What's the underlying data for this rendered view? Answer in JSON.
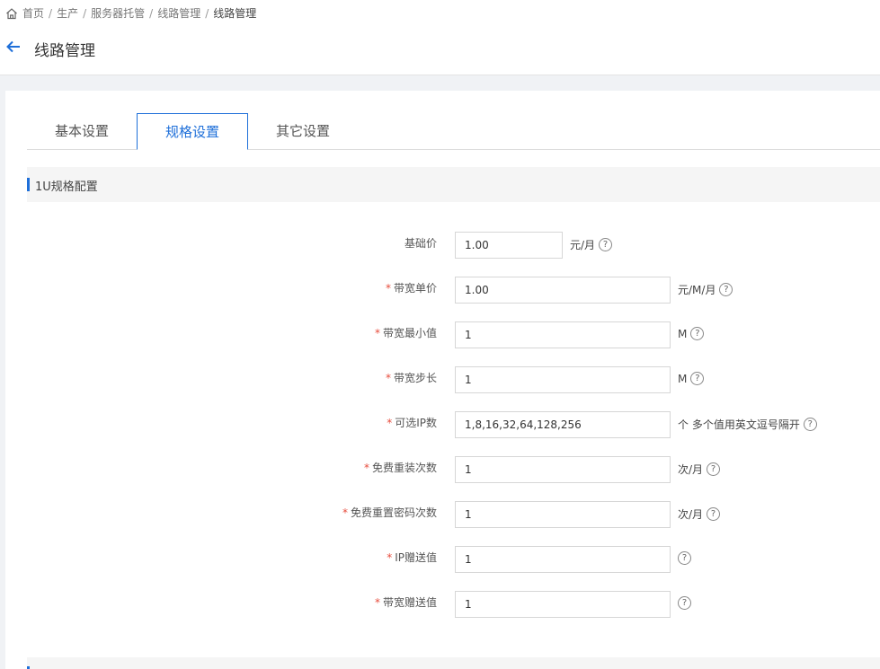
{
  "breadcrumb": [
    "首页",
    "生产",
    "服务器托管",
    "线路管理",
    "线路管理"
  ],
  "page": {
    "title": "线路管理"
  },
  "tabs": [
    "基本设置",
    "规格设置",
    "其它设置"
  ],
  "section": {
    "title": "1U规格配置"
  },
  "fields": [
    {
      "label": "基础价",
      "required": false,
      "value": "1.00",
      "unit": "元/月"
    },
    {
      "label": "带宽单价",
      "required": true,
      "value": "1.00",
      "unit": "元/M/月"
    },
    {
      "label": "带宽最小值",
      "required": true,
      "value": "1",
      "unit": "M"
    },
    {
      "label": "带宽步长",
      "required": true,
      "value": "1",
      "unit": "M"
    },
    {
      "label": "可选IP数",
      "required": true,
      "value": "1,8,16,32,64,128,256",
      "unit": "个 多个值用英文逗号隔开"
    },
    {
      "label": "免费重装次数",
      "required": true,
      "value": "1",
      "unit": "次/月"
    },
    {
      "label": "免费重置密码次数",
      "required": true,
      "value": "1",
      "unit": "次/月"
    },
    {
      "label": "IP赠送值",
      "required": true,
      "value": "1",
      "unit": ""
    },
    {
      "label": "带宽赠送值",
      "required": true,
      "value": "1",
      "unit": ""
    }
  ],
  "required_mark": "*",
  "help_glyph": "?",
  "colors": {
    "accent": "#1e6fd9",
    "required": "#e74c3c"
  }
}
